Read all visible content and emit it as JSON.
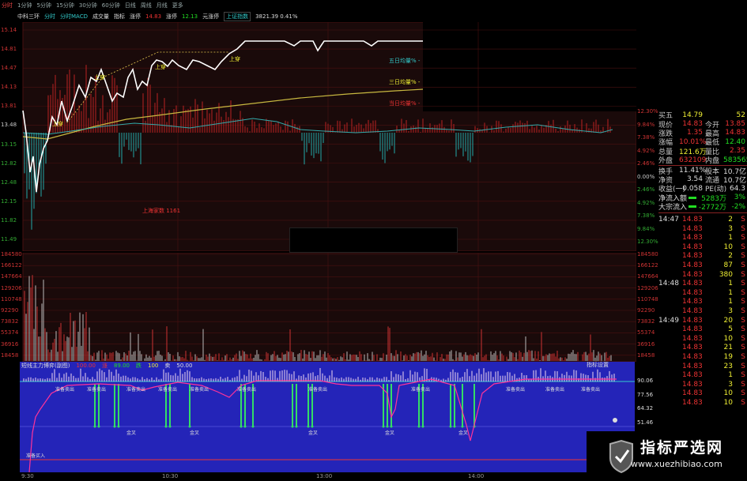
{
  "top_bar": {
    "tabs": [
      "分时",
      "1分钟",
      "5分钟",
      "15分钟",
      "30分钟",
      "60分钟",
      "日线",
      "周线",
      "月线",
      "更多"
    ],
    "active_tab": "分时"
  },
  "info_bar": {
    "name": "中科三环",
    "items": [
      "分时",
      "分时MACD",
      "成交量",
      "指标",
      "涨停"
    ],
    "price": "14.83",
    "label_rise": "涨停",
    "rise_price": "12.13",
    "limit": "元涨停",
    "index_label": "上证指数",
    "index_value": "3821.39 0.41%"
  },
  "main_chart": {
    "left_labels": [
      "15.14",
      "14.81",
      "14.47",
      "14.13",
      "13.81",
      "13.48",
      "13.15",
      "12.82",
      "12.48",
      "12.15",
      "11.82",
      "11.49"
    ],
    "right_labels": [
      "12.30%",
      "9.84%",
      "7.38%",
      "4.92%",
      "2.46%",
      "0.00%",
      "2.46%",
      "4.92%",
      "7.38%",
      "9.84%",
      "12.30%"
    ],
    "legend": [
      "五日均量% -",
      "三日均量% -",
      "当日均量% -"
    ],
    "annotations": [
      "上穿",
      "上穿",
      "上穿",
      "上穿"
    ],
    "note": "上海家数 1161"
  },
  "vol_chart": {
    "left_labels": [
      "184580",
      "166122",
      "147664",
      "129206",
      "110748",
      "92290",
      "73832",
      "55374",
      "36916",
      "18458"
    ],
    "right_labels": [
      "184580",
      "166122",
      "147664",
      "129206",
      "110748",
      "92290",
      "73832",
      "55374",
      "36916",
      "18458"
    ]
  },
  "indicator": {
    "header": [
      "短线主力博弈(副图)",
      "100.00",
      "涨",
      "89.00",
      "跌",
      "100",
      "卖",
      "50.00"
    ],
    "settings": "指标设置",
    "right_labels": [
      "90.06",
      "77.56",
      "64.32",
      "51.46",
      "38.80"
    ],
    "sell_labels": [
      "准备卖出",
      "准备卖出",
      "准备卖出",
      "准备卖出",
      "准备卖出",
      "准备卖出",
      "准备卖出",
      "准备卖出",
      "准备卖出",
      "准备卖出",
      "准备卖出"
    ],
    "buy_labels": [
      "准备买入"
    ],
    "gold_labels": [
      "金叉",
      "金叉",
      "金叉",
      "金叉",
      "金叉"
    ]
  },
  "time_axis": [
    "9:30",
    "10:30",
    "13:00",
    "14:00"
  ],
  "quote": {
    "rows": [
      {
        "k": "买五",
        "v": "14.79",
        "k2": "",
        "v2": "52",
        "c": "yellow",
        "c2": "yellow"
      },
      {
        "k": "现价",
        "v": "14.83",
        "k2": "今开",
        "v2": "13.85",
        "c": "red",
        "c2": "red"
      },
      {
        "k": "涨跌",
        "v": "1.35",
        "k2": "最高",
        "v2": "14.83",
        "c": "red",
        "c2": "red"
      },
      {
        "k": "涨幅",
        "v": "10.01%",
        "k2": "最低",
        "v2": "12.40",
        "c": "red",
        "c2": "green"
      },
      {
        "k": "总量",
        "v": "121.6万",
        "k2": "量比",
        "v2": "2.35",
        "c": "yellow",
        "c2": "red"
      },
      {
        "k": "外盘",
        "v": "632109",
        "k2": "内盘",
        "v2": "583565",
        "c": "red",
        "c2": "green"
      }
    ],
    "rows2": [
      {
        "k": "换手",
        "v": "11.41%",
        "k2": "股本",
        "v2": "10.7亿",
        "c": "white",
        "c2": "white"
      },
      {
        "k": "净资",
        "v": "3.54",
        "k2": "流通",
        "v2": "10.7亿",
        "c": "white",
        "c2": "white"
      },
      {
        "k": "收益(一)",
        "v": "0.058",
        "k2": "PE(动)",
        "v2": "64.3",
        "c": "white",
        "c2": "white"
      }
    ],
    "flows": [
      {
        "k": "净流入额",
        "v": "5283万",
        "p": "3%",
        "c": "green"
      },
      {
        "k": "大宗流入",
        "v": "-2772万",
        "p": "-2%",
        "c": "green"
      }
    ]
  },
  "ticks": [
    {
      "t": "14:47",
      "p": "14.83",
      "v": "2",
      "d": "S"
    },
    {
      "t": "",
      "p": "14.83",
      "v": "3",
      "d": "S"
    },
    {
      "t": "",
      "p": "14.83",
      "v": "1",
      "d": "S"
    },
    {
      "t": "",
      "p": "14.83",
      "v": "10",
      "d": "S"
    },
    {
      "t": "",
      "p": "14.83",
      "v": "2",
      "d": "S"
    },
    {
      "t": "",
      "p": "14.83",
      "v": "87",
      "d": "S"
    },
    {
      "t": "",
      "p": "14.83",
      "v": "380",
      "d": "S"
    },
    {
      "t": "14:48",
      "p": "14.83",
      "v": "1",
      "d": "S"
    },
    {
      "t": "",
      "p": "14.83",
      "v": "1",
      "d": "S"
    },
    {
      "t": "",
      "p": "14.83",
      "v": "1",
      "d": "S"
    },
    {
      "t": "",
      "p": "14.83",
      "v": "3",
      "d": "S"
    },
    {
      "t": "14:49",
      "p": "14.83",
      "v": "20",
      "d": "S"
    },
    {
      "t": "",
      "p": "14.83",
      "v": "5",
      "d": "S"
    },
    {
      "t": "",
      "p": "14.83",
      "v": "10",
      "d": "S"
    },
    {
      "t": "",
      "p": "14.83",
      "v": "21",
      "d": "S"
    },
    {
      "t": "",
      "p": "14.83",
      "v": "19",
      "d": "S"
    },
    {
      "t": "",
      "p": "14.83",
      "v": "23",
      "d": "S"
    },
    {
      "t": "",
      "p": "14.83",
      "v": "1",
      "d": "S"
    },
    {
      "t": "",
      "p": "14.83",
      "v": "3",
      "d": "S"
    },
    {
      "t": "",
      "p": "14.83",
      "v": "10",
      "d": "S"
    },
    {
      "t": "",
      "p": "14.83",
      "v": "10",
      "d": "S"
    }
  ],
  "watermark": {
    "title": "指标严选网",
    "url": "www.xuezhibiao.com"
  }
}
